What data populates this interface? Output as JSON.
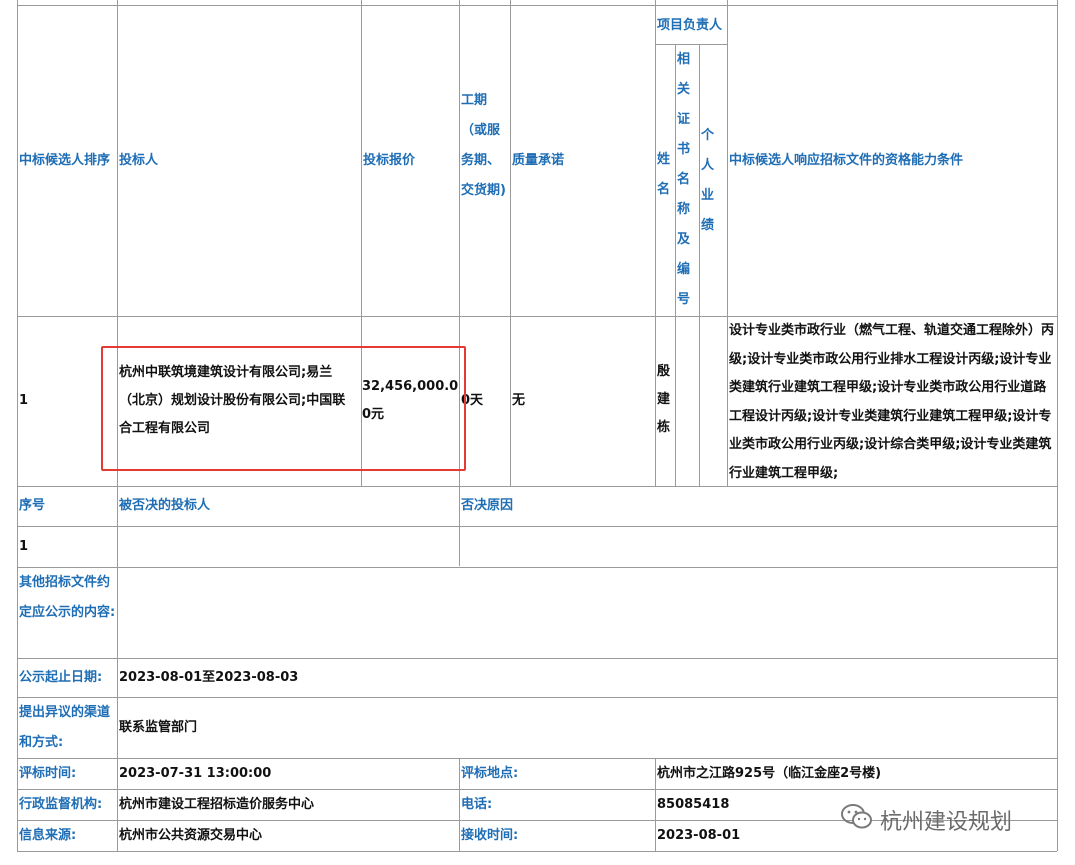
{
  "winning_table": {
    "headers": {
      "rank": "中标候选人排序",
      "bidder": "投标人",
      "price": "投标报价",
      "duration": "工期（或服务期、交货期)",
      "quality": "质量承诺",
      "project_manager": "项目负责人",
      "name": "姓名",
      "certificate": "相关证书名称及编号",
      "performance": "个人业绩",
      "qualification": "中标候选人响应招标文件的资格能力条件"
    },
    "row": {
      "rank": "1",
      "bidder": "杭州中联筑境建筑设计有限公司;易兰（北京）规划设计股份有限公司;中国联合工程有限公司",
      "price": "32,456,000.00元",
      "duration": "0天",
      "quality": "无",
      "name": "殷建栋",
      "certificate": "",
      "performance": "",
      "qualification": "设计专业类市政行业（燃气工程、轨道交通工程除外）丙级;设计专业类市政公用行业排水工程设计丙级;设计专业类建筑行业建筑工程甲级;设计专业类市政公用行业道路工程设计丙级;设计专业类建筑行业建筑工程甲级;设计专业类市政公用行业丙级;设计综合类甲级;设计专业类建筑行业建筑工程甲级;"
    }
  },
  "rejected": {
    "headers": {
      "seq": "序号",
      "bidder": "被否决的投标人",
      "reason": "否决原因"
    },
    "row": {
      "seq": "1",
      "bidder": "",
      "reason": ""
    }
  },
  "info": {
    "other_label": "其他招标文件约定应公示的内容:",
    "other_value": "",
    "period_label": "公示起止日期:",
    "period_value": "2023-08-01至2023-08-03",
    "objection_label": "提出异议的渠道和方式:",
    "objection_value": "联系监管部门",
    "eval_time_label": "评标时间:",
    "eval_time_value": "2023-07-31 13:00:00",
    "eval_place_label": "评标地点:",
    "eval_place_value": "杭州市之江路925号（临江金座2号楼)",
    "supervisor_label": "行政监督机构:",
    "supervisor_value": "杭州市建设工程招标造价服务中心",
    "phone_label": "电话:",
    "phone_value": "85085418",
    "source_label": "信息来源:",
    "source_value": "杭州市公共资源交易中心",
    "receive_label": "接收时间:",
    "receive_value": "2023-08-01"
  },
  "watermark": {
    "text": "杭州建设规划",
    "icon": "wechat-icon"
  },
  "colors": {
    "label": "#1f6eb5",
    "grid": "#9a9a9a",
    "highlight": "#e53935"
  }
}
